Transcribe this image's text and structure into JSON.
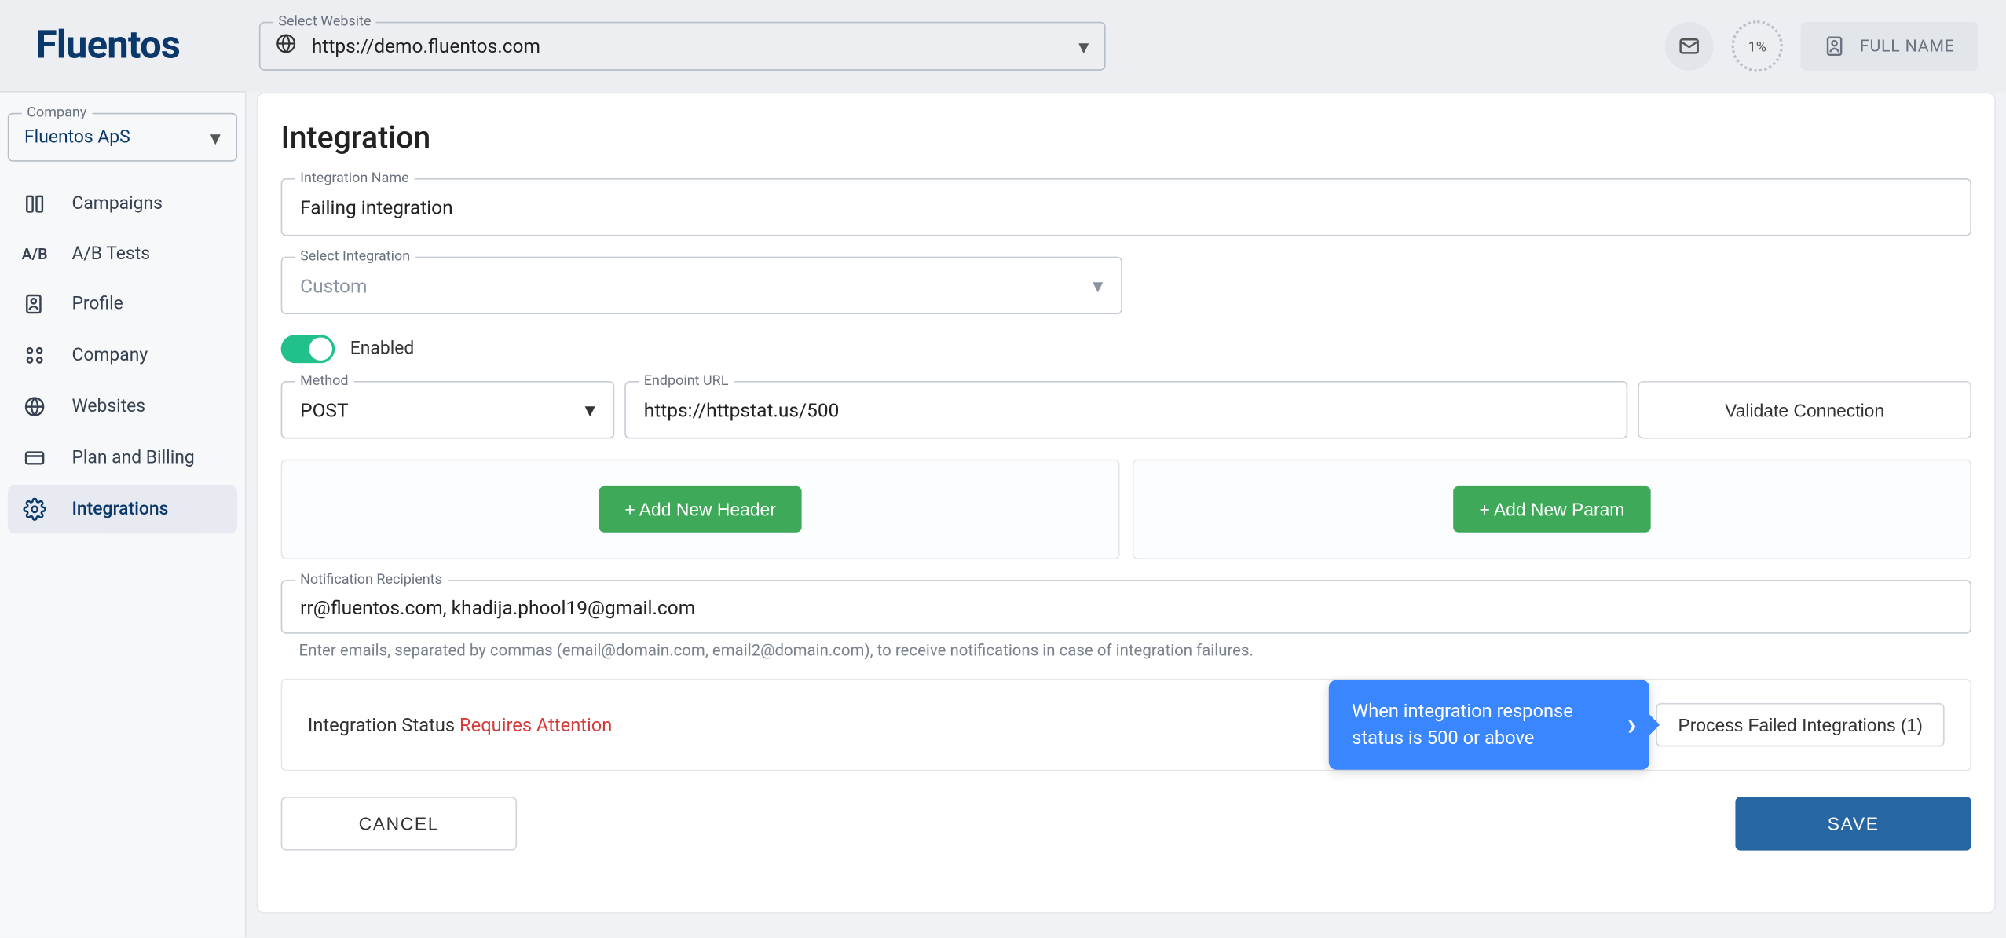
{
  "brand": "Fluentos",
  "website_select": {
    "label": "Select Website",
    "value": "https://demo.fluentos.com"
  },
  "progress": "1%",
  "full_name": "FULL NAME",
  "company_select": {
    "label": "Company",
    "value": "Fluentos ApS"
  },
  "nav": {
    "campaigns": "Campaigns",
    "abtests": "A/B Tests",
    "profile": "Profile",
    "company": "Company",
    "websites": "Websites",
    "billing": "Plan and Billing",
    "integrations": "Integrations"
  },
  "page": {
    "title": "Integration",
    "name_label": "Integration Name",
    "name_value": "Failing integration",
    "select_integration_label": "Select Integration",
    "select_integration_value": "Custom",
    "enabled_label": "Enabled",
    "method_label": "Method",
    "method_value": "POST",
    "endpoint_label": "Endpoint URL",
    "endpoint_value": "https://httpstat.us/500",
    "validate_btn": "Validate Connection",
    "add_header_btn": "+ Add New Header",
    "add_param_btn": "+ Add New Param",
    "recipients_label": "Notification Recipients",
    "recipients_value": "rr@fluentos.com, khadija.phool19@gmail.com",
    "recipients_hint": "Enter emails, separated by commas (email@domain.com, email2@domain.com), to receive notifications in case of integration failures.",
    "status_label": "Integration Status",
    "status_value": "Requires Attention",
    "process_btn": "Process Failed Integrations (1)",
    "tooltip": "When integration response status is 500 or above",
    "cancel_btn": "CANCEL",
    "save_btn": "SAVE"
  }
}
